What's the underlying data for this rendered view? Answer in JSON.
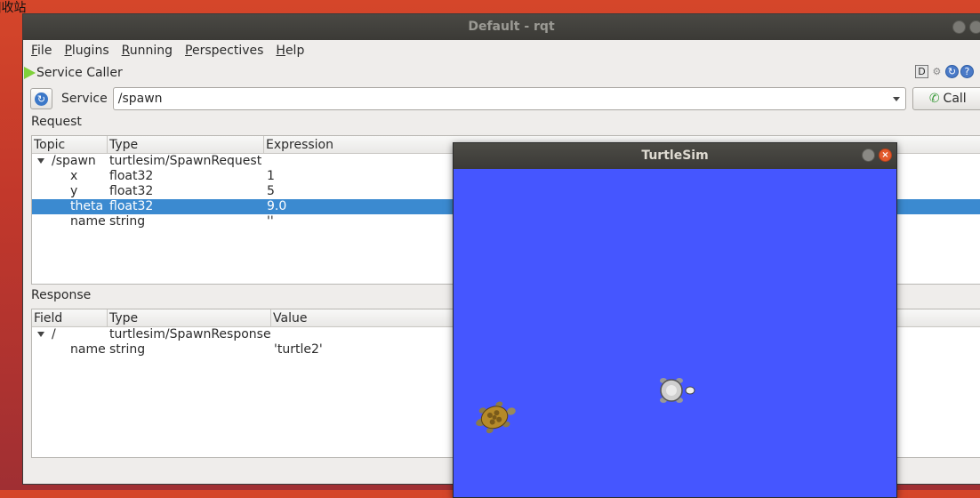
{
  "desktop_label": "]收站",
  "rqt": {
    "title": "Default - rqt",
    "menu": [
      "File",
      "Plugins",
      "Running",
      "Perspectives",
      "Help"
    ],
    "menu_mnemonic": [
      "F",
      "P",
      "R",
      "P",
      "H"
    ],
    "plugin_title": "Service Caller",
    "plugin_tools_text": "- O",
    "service_label": "Service",
    "service_value": "/spawn",
    "call_label": "Call",
    "request_label": "Request",
    "request_headers": [
      "Topic",
      "Type",
      "Expression"
    ],
    "request_rows": [
      {
        "topic": "/spawn",
        "type": "turtlesim/SpawnRequest",
        "expr": "",
        "expanded": true,
        "selected": false
      },
      {
        "topic": "x",
        "type": "float32",
        "expr": "1",
        "selected": false
      },
      {
        "topic": "y",
        "type": "float32",
        "expr": "5",
        "selected": false
      },
      {
        "topic": "theta",
        "type": "float32",
        "expr": "9.0",
        "selected": true
      },
      {
        "topic": "name",
        "type": "string",
        "expr": "''",
        "selected": false
      }
    ],
    "response_label": "Response",
    "response_headers": [
      "Field",
      "Type",
      "Value"
    ],
    "response_rows": [
      {
        "field": "/",
        "type": "turtlesim/SpawnResponse",
        "value": "",
        "expanded": true
      },
      {
        "field": "name",
        "type": "string",
        "value": "'turtle2'"
      }
    ]
  },
  "turtlesim": {
    "title": "TurtleSim",
    "background_color": "#4556ff",
    "close_glyph": "×"
  }
}
